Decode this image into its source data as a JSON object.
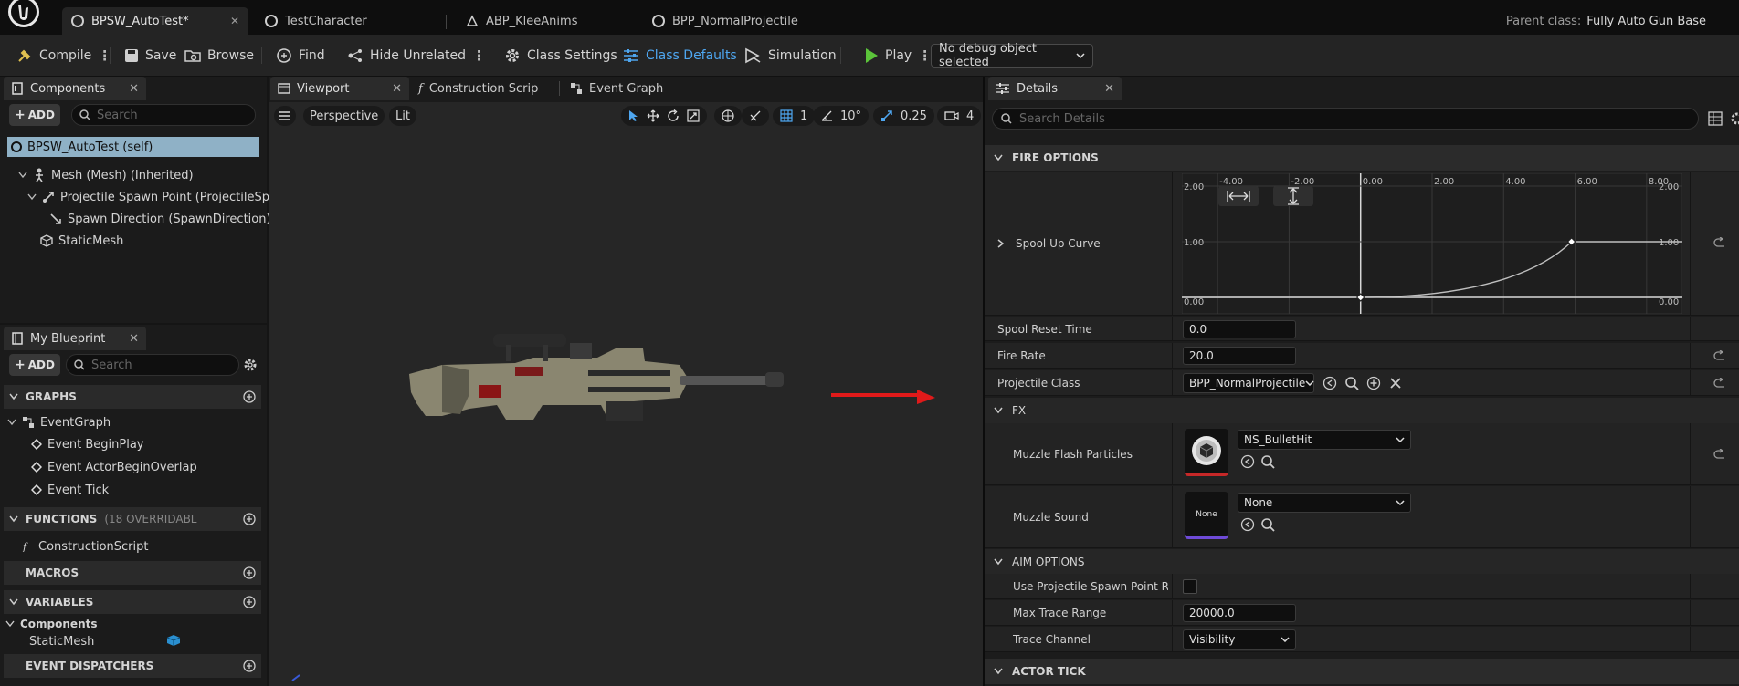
{
  "titlebar": {
    "tabs": [
      {
        "label": "BPSW_AutoTest*"
      },
      {
        "label": "TestCharacter"
      },
      {
        "label": "ABP_KleeAnims"
      },
      {
        "label": "BPP_NormalProjectile"
      }
    ],
    "parent_class_label": "Parent class:",
    "parent_class_value": "Fully Auto Gun Base"
  },
  "toolbar": {
    "compile": "Compile",
    "save": "Save",
    "browse": "Browse",
    "find": "Find",
    "hide_unrelated": "Hide Unrelated",
    "class_settings": "Class Settings",
    "class_defaults": "Class Defaults",
    "simulation": "Simulation",
    "play": "Play",
    "debug_object": "No debug object selected"
  },
  "components": {
    "tab": "Components",
    "add": "ADD",
    "search_placeholder": "Search",
    "items": [
      {
        "label": "BPSW_AutoTest (self)"
      },
      {
        "label": "Mesh (Mesh) (Inherited)"
      },
      {
        "label": "Projectile Spawn Point (ProjectileSpaw"
      },
      {
        "label": "Spawn Direction (SpawnDirection) (I"
      },
      {
        "label": "StaticMesh"
      }
    ]
  },
  "my_blueprint": {
    "tab": "My Blueprint",
    "add": "ADD",
    "search_placeholder": "Search",
    "graphs_header": "GRAPHS",
    "event_graph": "EventGraph",
    "events": [
      "Event BeginPlay",
      "Event ActorBeginOverlap",
      "Event Tick"
    ],
    "functions_header": "FUNCTIONS",
    "functions_sub": "(18 OVERRIDABL",
    "construction_script": "ConstructionScript",
    "macros_header": "MACROS",
    "variables_header": "VARIABLES",
    "components_group": "Components",
    "static_mesh_var": "StaticMesh",
    "dispatchers_header": "EVENT DISPATCHERS"
  },
  "center_tabs": {
    "viewport": "Viewport",
    "construction": "Construction Scrip",
    "event_graph": "Event Graph"
  },
  "viewport_toolbar": {
    "perspective": "Perspective",
    "lit": "Lit",
    "grid_snap": "1",
    "rot_snap": "10°",
    "scale_snap": "0.25",
    "camera_speed": "4"
  },
  "details": {
    "tab": "Details",
    "search_placeholder": "Search Details",
    "fire_options": "FIRE OPTIONS",
    "spool_up_curve": "Spool Up Curve",
    "curve": {
      "x_ticks": [
        "-4.00",
        "-2.00",
        "0.00",
        "2.00",
        "4.00",
        "6.00",
        "8.00"
      ],
      "y_left": [
        "2.00",
        "1.00",
        "0.00"
      ],
      "y_right": [
        "2.00",
        "1.00",
        "0.00"
      ],
      "keys": [
        {
          "x": 0.0,
          "y": 0.0
        },
        {
          "x": 5.9,
          "y": 1.0
        }
      ]
    },
    "spool_reset_time_label": "Spool Reset Time",
    "spool_reset_time": "0.0",
    "fire_rate_label": "Fire Rate",
    "fire_rate": "20.0",
    "projectile_class_label": "Projectile Class",
    "projectile_class": "BPP_NormalProjectile",
    "fx": "FX",
    "muzzle_flash_label": "Muzzle Flash Particles",
    "muzzle_flash": "NS_BulletHit",
    "muzzle_sound_label": "Muzzle Sound",
    "muzzle_sound": "None",
    "muzzle_sound_thumb": "None",
    "aim_options": "AIM OPTIONS",
    "use_spawn_rot_label": "Use Projectile Spawn Point Rotatic",
    "max_trace_range_label": "Max Trace Range",
    "max_trace_range": "20000.0",
    "trace_channel_label": "Trace Channel",
    "trace_channel": "Visibility",
    "actor_tick": "ACTOR TICK"
  },
  "colors": {
    "accent_blue": "#4ea6f0",
    "play_green": "#5bc43a",
    "selected_row": "#8fb1c6",
    "arrow_red": "#e01a1a"
  }
}
